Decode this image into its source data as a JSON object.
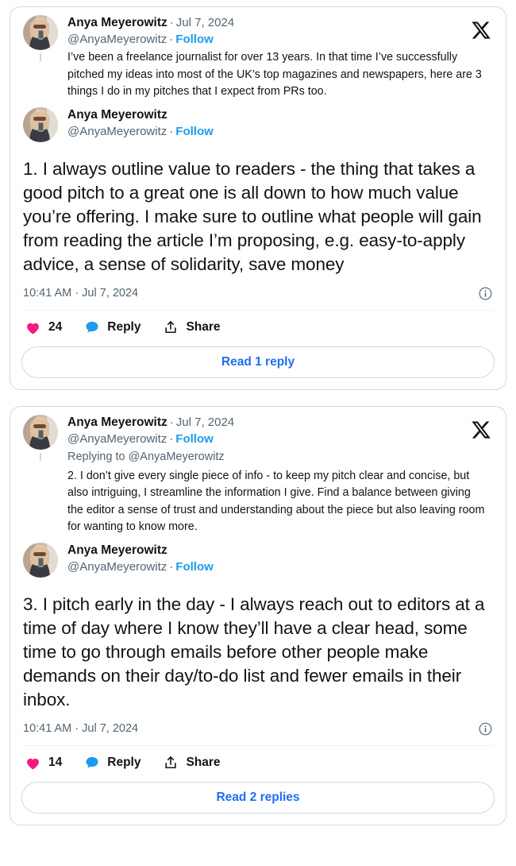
{
  "brand": {
    "logo_name": "x-logo",
    "accent_blue": "#1d9bf0",
    "link_blue": "#1d6ff2",
    "like_pink": "#f91880",
    "text_gray": "#536471",
    "border_gray": "#cfd9de"
  },
  "cards": [
    {
      "parent": {
        "display_name": "Anya Meyerowitz",
        "separator": "·",
        "date": "Jul 7, 2024",
        "handle": "@AnyaMeyerowitz",
        "follow_label": "Follow",
        "text": "I’ve been a freelance journalist for over 13 years. In that time I’ve successfully pitched my ideas into most of the UK’s top magazines and newspapers, here are 3 things I do in my pitches that I expect from PRs too."
      },
      "main": {
        "display_name": "Anya Meyerowitz",
        "handle": "@AnyaMeyerowitz",
        "separator": "·",
        "follow_label": "Follow",
        "text": "1. I always outline value to readers - the thing that takes a good pitch to a great one is all down to how much value you’re offering. I make sure to outline what people will gain from reading the article I’m proposing, e.g. easy-to-apply advice, a sense of solidarity, save money",
        "timestamp": "10:41 AM · Jul 7, 2024",
        "info_icon": "info-icon"
      },
      "actions": {
        "like_count": "24",
        "like_icon": "heart-icon",
        "reply_label": "Reply",
        "reply_icon": "reply-bubble-icon",
        "share_label": "Share",
        "share_icon": "share-icon"
      },
      "read_replies_label": "Read 1 reply"
    },
    {
      "parent": {
        "display_name": "Anya Meyerowitz",
        "separator": "·",
        "date": "Jul 7, 2024",
        "handle": "@AnyaMeyerowitz",
        "follow_label": "Follow",
        "replying_to": "Replying to @AnyaMeyerowitz",
        "text": "2. I don’t give every single piece of info - to keep my pitch clear and concise, but also intriguing, I streamline the information I give. Find a balance between giving the editor a sense of trust and understanding about the piece but also leaving room for wanting to know more."
      },
      "main": {
        "display_name": "Anya Meyerowitz",
        "handle": "@AnyaMeyerowitz",
        "separator": "·",
        "follow_label": "Follow",
        "text": "3. I pitch early in the day - I always reach out to editors at a time of day where I know they’ll have a clear head, some time to go through emails before other people make demands on their day/to-do list and fewer emails in their inbox.",
        "timestamp": "10:41 AM · Jul 7, 2024",
        "info_icon": "info-icon"
      },
      "actions": {
        "like_count": "14",
        "like_icon": "heart-icon",
        "reply_label": "Reply",
        "reply_icon": "reply-bubble-icon",
        "share_label": "Share",
        "share_icon": "share-icon"
      },
      "read_replies_label": "Read 2 replies"
    }
  ]
}
